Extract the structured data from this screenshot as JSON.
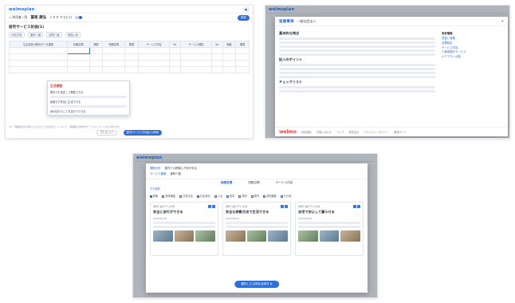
{
  "brand": {
    "logo_text": "welmoplan",
    "footer_logo": "welmo",
    "accent": "#2f6fd6",
    "warn": "#d64a4a"
  },
  "screen1": {
    "subbar": {
      "back": "< 利用者一覧",
      "patient": "冨尾 康弘",
      "kana": "トミオ ヤスヒロ",
      "save": "保存"
    },
    "section_title": "居宅サービス計画(1)",
    "filters": [
      "作成日時",
      "通所介護",
      "訪問介護",
      "短期入所"
    ],
    "table_headers": [
      "生活全般の解決すべき課題",
      "長期目標",
      "期間",
      "短期目標",
      "期間",
      "サービス内容",
      "※1",
      "サービス種別",
      "※2",
      "頻度",
      "期間"
    ],
    "popup": {
      "title": "生活課題",
      "lines": [
        "屋内でも安定して移動できる",
        "転倒せず安全に生活できる",
        "身の回りのことを自分でできる"
      ]
    },
    "footnote": "※1「保険給付の対象となるかどうかの区分」について、保険給付対象内サービスについては○印を付す。",
    "buttons": {
      "preview": "プレビュー",
      "print": "居宅サービス計画(1)印刷"
    }
  },
  "screen2": {
    "modal_title": "留意事項",
    "modal_sub": "一般社団法人",
    "h_basic": "基本的な視点",
    "h_points": "記入のポイント",
    "h_check": "チェックリスト",
    "side_head": "参考情報",
    "side_links": [
      "見直し時期",
      "目標設定",
      "サービス内容",
      "介護保険外サービス",
      "ケアプラン点検"
    ],
    "footer_links": [
      "利用規約",
      "お問い合わせ",
      "ヘルプ",
      "運営会社",
      "プライバシーポリシー",
      "関連サイト"
    ]
  },
  "screen3": {
    "head_label1": "課題分析",
    "head_value1": "屋内での移動に不安がある",
    "head_label2": "サービス種類",
    "head_value2": "通所介護",
    "tabs": [
      "長期目標",
      "短期目標",
      "サービス内容"
    ],
    "active_tab": "長期目標",
    "tag_group": "タグ選択",
    "tags": [
      "移動",
      "身体機能",
      "日常生活",
      "社会参加",
      "入浴",
      "食事",
      "排泄",
      "更衣",
      "認知機能",
      "その他"
    ],
    "cards": [
      {
        "tag": "通所介護モデル文例",
        "title": "安全に歩行ができる",
        "meta": "2024/01/10"
      },
      {
        "tag": "通所介護モデル文例",
        "title": "安全な移動方法で生活できる",
        "meta": "2024/02/02"
      },
      {
        "tag": "通所介護モデル文例",
        "title": "自宅で安心して暮らせる",
        "meta": "2024/03/15"
      }
    ],
    "cta": "選択した文例を反映する"
  }
}
